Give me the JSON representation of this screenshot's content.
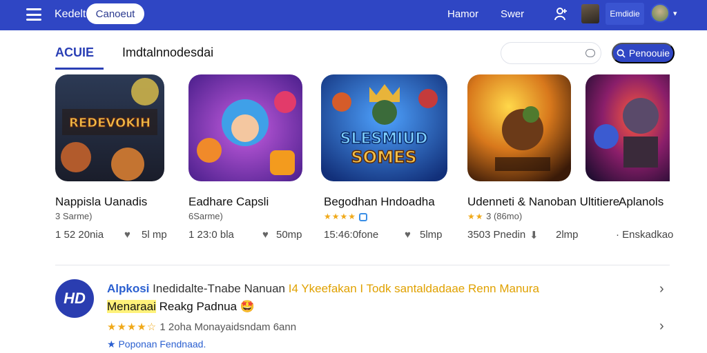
{
  "header": {
    "brand": "Kedelt",
    "cancel_label": "Canoeut",
    "nav": [
      "Hamor",
      "Swer"
    ],
    "account_label": "Emdidie"
  },
  "tabs": [
    {
      "label": "ACUIE",
      "active": true
    },
    {
      "label": "Imdtalnnodesdai",
      "active": false
    }
  ],
  "search": {
    "placeholder": "",
    "button_label": "Penoouie"
  },
  "cards": [
    {
      "title": "Nappisla Uanadis",
      "subtitle": "3 Sarme)",
      "stat": "1 52 20nia",
      "likes": "5l mp",
      "art_text": "REDEVOKIH"
    },
    {
      "title": "Eadhare Capsli",
      "subtitle": "6Sarme)",
      "stat": "1 23:0 bla",
      "likes": "50mp",
      "art_text": ""
    },
    {
      "title": "Begodhan Hndoadha",
      "subtitle": "",
      "stat": "15:46:0fone",
      "likes": "5lmp",
      "art_text": "SLESMIUD SOMES",
      "stars": "★★★★"
    },
    {
      "title": "Udenneti & Nanoban Ultitiere",
      "subtitle": "3 (86mo)",
      "stat": "3503 Pnedin",
      "likes": "2lmp",
      "stars": "★★"
    },
    {
      "title": "Aplanols",
      "subtitle": "",
      "stat": "",
      "likes": "Enskadkao"
    }
  ],
  "listing": {
    "logo_text": "HD",
    "name": "Alpkosi",
    "description": "Inedidalte-Tnabe Nanuan",
    "highlight": "I4 Ykeefakan I Todk santaldadaae Renn Manura",
    "line2_marked": "Menaraai",
    "line2_rest": "Reakg Padnua 🤩",
    "rating_stars": "★★★★☆",
    "rating_text": "1 2oha Monayaidsndam 6ann",
    "footer": "★ Poponan Fendnaad."
  },
  "colors": {
    "primary": "#2f46c4",
    "accent": "#f0a919"
  }
}
